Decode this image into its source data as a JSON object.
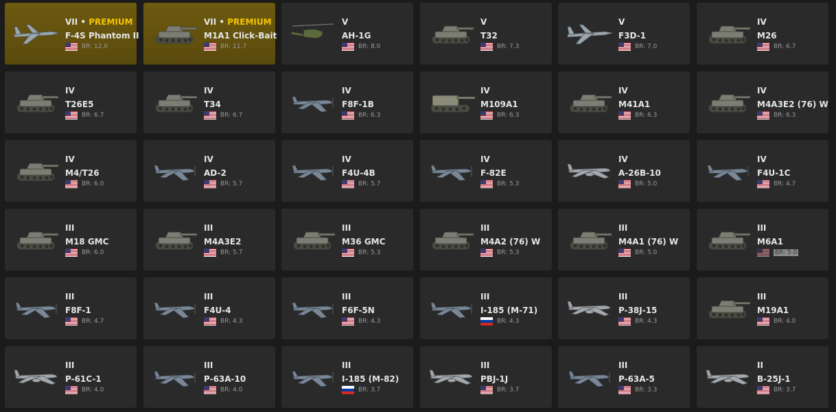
{
  "colors": {
    "card": "#2a2a2a",
    "premium_card": "#5f4f0e",
    "premium_text": "#f5c400",
    "background": "#1b1b1b"
  },
  "vehicles": [
    {
      "tier": "VII",
      "premium_label": "PREMIUM",
      "name": "F-4S Phantom II",
      "flag": "us",
      "br": "BR: 12.0",
      "icon": "jet-aircraft-icon",
      "premium": true,
      "highlight": false
    },
    {
      "tier": "VII",
      "premium_label": "PREMIUM",
      "name": "M1A1 Click-Bait",
      "flag": "us",
      "br": "BR: 11.7",
      "icon": "tank-icon",
      "premium": true,
      "highlight": false
    },
    {
      "tier": "V",
      "premium_label": "",
      "name": "AH-1G",
      "flag": "us",
      "br": "BR: 8.0",
      "icon": "helicopter-icon",
      "premium": false,
      "highlight": false
    },
    {
      "tier": "V",
      "premium_label": "",
      "name": "T32",
      "flag": "us",
      "br": "BR: 7.3",
      "icon": "tank-icon",
      "premium": false,
      "highlight": false
    },
    {
      "tier": "V",
      "premium_label": "",
      "name": "F3D-1",
      "flag": "us",
      "br": "BR: 7.0",
      "icon": "jet-aircraft-icon",
      "premium": false,
      "highlight": false
    },
    {
      "tier": "IV",
      "premium_label": "",
      "name": "M26",
      "flag": "us",
      "br": "BR: 6.7",
      "icon": "tank-icon",
      "premium": false,
      "highlight": false
    },
    {
      "tier": "IV",
      "premium_label": "",
      "name": "T26E5",
      "flag": "us",
      "br": "BR: 6.7",
      "icon": "tank-icon",
      "premium": false,
      "highlight": false
    },
    {
      "tier": "IV",
      "premium_label": "",
      "name": "T34",
      "flag": "us",
      "br": "BR: 6.7",
      "icon": "tank-icon",
      "premium": false,
      "highlight": false
    },
    {
      "tier": "IV",
      "premium_label": "",
      "name": "F8F-1B",
      "flag": "us",
      "br": "BR: 6.3",
      "icon": "prop-aircraft-icon",
      "premium": false,
      "highlight": false
    },
    {
      "tier": "IV",
      "premium_label": "",
      "name": "M109A1",
      "flag": "us",
      "br": "BR: 6.3",
      "icon": "artillery-icon",
      "premium": false,
      "highlight": false
    },
    {
      "tier": "IV",
      "premium_label": "",
      "name": "M41A1",
      "flag": "us",
      "br": "BR: 6.3",
      "icon": "tank-icon",
      "premium": false,
      "highlight": false
    },
    {
      "tier": "IV",
      "premium_label": "",
      "name": "M4A3E2 (76) W",
      "flag": "us",
      "br": "BR: 6.3",
      "icon": "tank-icon",
      "premium": false,
      "highlight": false
    },
    {
      "tier": "IV",
      "premium_label": "",
      "name": "M4/T26",
      "flag": "us",
      "br": "BR: 6.0",
      "icon": "tank-icon",
      "premium": false,
      "highlight": false
    },
    {
      "tier": "IV",
      "premium_label": "",
      "name": "AD-2",
      "flag": "us",
      "br": "BR: 5.7",
      "icon": "prop-aircraft-icon",
      "premium": false,
      "highlight": false
    },
    {
      "tier": "IV",
      "premium_label": "",
      "name": "F4U-4B",
      "flag": "us",
      "br": "BR: 5.7",
      "icon": "prop-aircraft-icon",
      "premium": false,
      "highlight": false
    },
    {
      "tier": "IV",
      "premium_label": "",
      "name": "F-82E",
      "flag": "us",
      "br": "BR: 5.3",
      "icon": "prop-aircraft-icon",
      "premium": false,
      "highlight": false
    },
    {
      "tier": "IV",
      "premium_label": "",
      "name": "A-26B-10",
      "flag": "us",
      "br": "BR: 5.0",
      "icon": "bomber-aircraft-icon",
      "premium": false,
      "highlight": false
    },
    {
      "tier": "IV",
      "premium_label": "",
      "name": "F4U-1C",
      "flag": "us",
      "br": "BR: 4.7",
      "icon": "prop-aircraft-icon",
      "premium": false,
      "highlight": false
    },
    {
      "tier": "III",
      "premium_label": "",
      "name": "M18 GMC",
      "flag": "us",
      "br": "BR: 6.0",
      "icon": "tank-icon",
      "premium": false,
      "highlight": false
    },
    {
      "tier": "III",
      "premium_label": "",
      "name": "M4A3E2",
      "flag": "us",
      "br": "BR: 5.7",
      "icon": "tank-icon",
      "premium": false,
      "highlight": false
    },
    {
      "tier": "III",
      "premium_label": "",
      "name": "M36 GMC",
      "flag": "us",
      "br": "BR: 5.3",
      "icon": "tank-icon",
      "premium": false,
      "highlight": false
    },
    {
      "tier": "III",
      "premium_label": "",
      "name": "M4A2 (76) W",
      "flag": "us",
      "br": "BR: 5.3",
      "icon": "tank-icon",
      "premium": false,
      "highlight": false
    },
    {
      "tier": "III",
      "premium_label": "",
      "name": "M4A1 (76) W",
      "flag": "us",
      "br": "BR: 5.0",
      "icon": "tank-icon",
      "premium": false,
      "highlight": false
    },
    {
      "tier": "III",
      "premium_label": "",
      "name": "M6A1",
      "flag": "us",
      "br": "BR: 5.0",
      "icon": "tank-icon",
      "premium": false,
      "highlight": true
    },
    {
      "tier": "III",
      "premium_label": "",
      "name": "F8F-1",
      "flag": "us",
      "br": "BR: 4.7",
      "icon": "prop-aircraft-icon",
      "premium": false,
      "highlight": false
    },
    {
      "tier": "III",
      "premium_label": "",
      "name": "F4U-4",
      "flag": "us",
      "br": "BR: 4.3",
      "icon": "prop-aircraft-icon",
      "premium": false,
      "highlight": false
    },
    {
      "tier": "III",
      "premium_label": "",
      "name": "F6F-5N",
      "flag": "us",
      "br": "BR: 4.3",
      "icon": "prop-aircraft-icon",
      "premium": false,
      "highlight": false
    },
    {
      "tier": "III",
      "premium_label": "",
      "name": "I-185 (M-71)",
      "flag": "ru",
      "br": "BR: 4.3",
      "icon": "prop-aircraft-icon",
      "premium": false,
      "highlight": false
    },
    {
      "tier": "III",
      "premium_label": "",
      "name": "P-38J-15",
      "flag": "us",
      "br": "BR: 4.3",
      "icon": "bomber-aircraft-icon",
      "premium": false,
      "highlight": false
    },
    {
      "tier": "III",
      "premium_label": "",
      "name": "M19A1",
      "flag": "us",
      "br": "BR: 4.0",
      "icon": "tank-icon",
      "premium": false,
      "highlight": false
    },
    {
      "tier": "III",
      "premium_label": "",
      "name": "P-61C-1",
      "flag": "us",
      "br": "BR: 4.0",
      "icon": "bomber-aircraft-icon",
      "premium": false,
      "highlight": false
    },
    {
      "tier": "III",
      "premium_label": "",
      "name": "P-63A-10",
      "flag": "us",
      "br": "BR: 4.0",
      "icon": "prop-aircraft-icon",
      "premium": false,
      "highlight": false
    },
    {
      "tier": "III",
      "premium_label": "",
      "name": "I-185 (M-82)",
      "flag": "ru",
      "br": "BR: 3.7",
      "icon": "prop-aircraft-icon",
      "premium": false,
      "highlight": false
    },
    {
      "tier": "III",
      "premium_label": "",
      "name": "PBJ-1J",
      "flag": "us",
      "br": "BR: 3.7",
      "icon": "bomber-aircraft-icon",
      "premium": false,
      "highlight": false
    },
    {
      "tier": "III",
      "premium_label": "",
      "name": "P-63A-5",
      "flag": "us",
      "br": "BR: 3.3",
      "icon": "prop-aircraft-icon",
      "premium": false,
      "highlight": false
    },
    {
      "tier": "II",
      "premium_label": "",
      "name": "B-25J-1",
      "flag": "us",
      "br": "BR: 3.7",
      "icon": "bomber-aircraft-icon",
      "premium": false,
      "highlight": false
    }
  ]
}
